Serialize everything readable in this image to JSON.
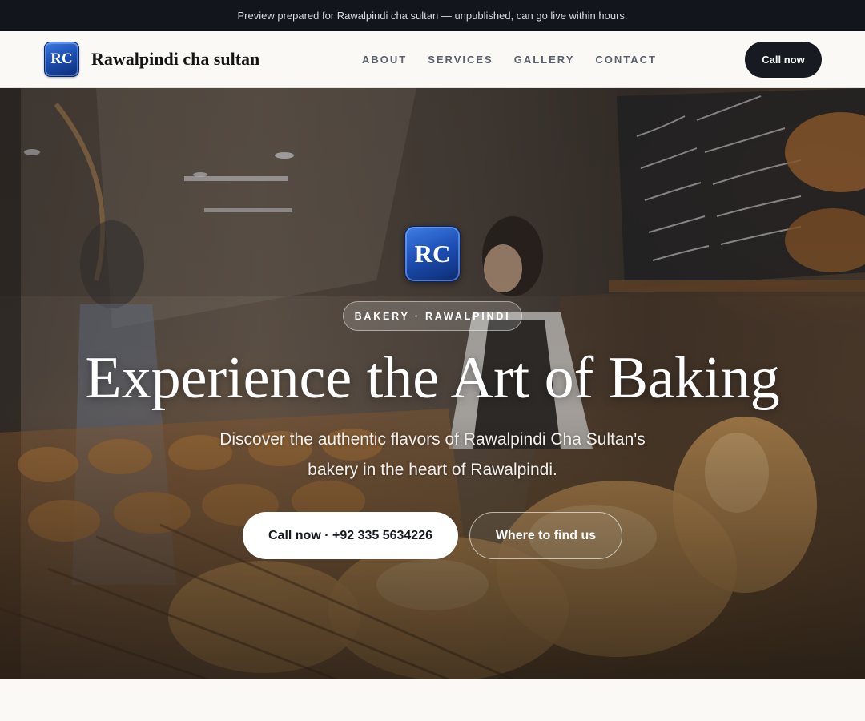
{
  "preview_banner": "Preview prepared for Rawalpindi cha sultan — unpublished, can go live within hours.",
  "header": {
    "logo_text": "RC",
    "brand_name": "Rawalpindi cha sultan",
    "nav": [
      "ABOUT",
      "SERVICES",
      "GALLERY",
      "CONTACT"
    ],
    "cta_label": "Call now"
  },
  "hero": {
    "logo_text": "RC",
    "eyebrow": "BAKERY · RAWALPINDI",
    "title": "Experience the Art of Baking",
    "subtitle": "Discover the authentic flavors of Rawalpindi Cha Sultan's bakery in the heart of Rawalpindi.",
    "primary_button": "Call now · +92 335 5634226",
    "secondary_button": "Where to find us",
    "background_image": "bakery-interior-photo"
  },
  "colors": {
    "banner_bg": "#12151b",
    "header_bg": "#faf9f6",
    "cta_bg": "#171a20",
    "logo_blue": "#1d4fb3",
    "hero_text": "#ffffff"
  }
}
